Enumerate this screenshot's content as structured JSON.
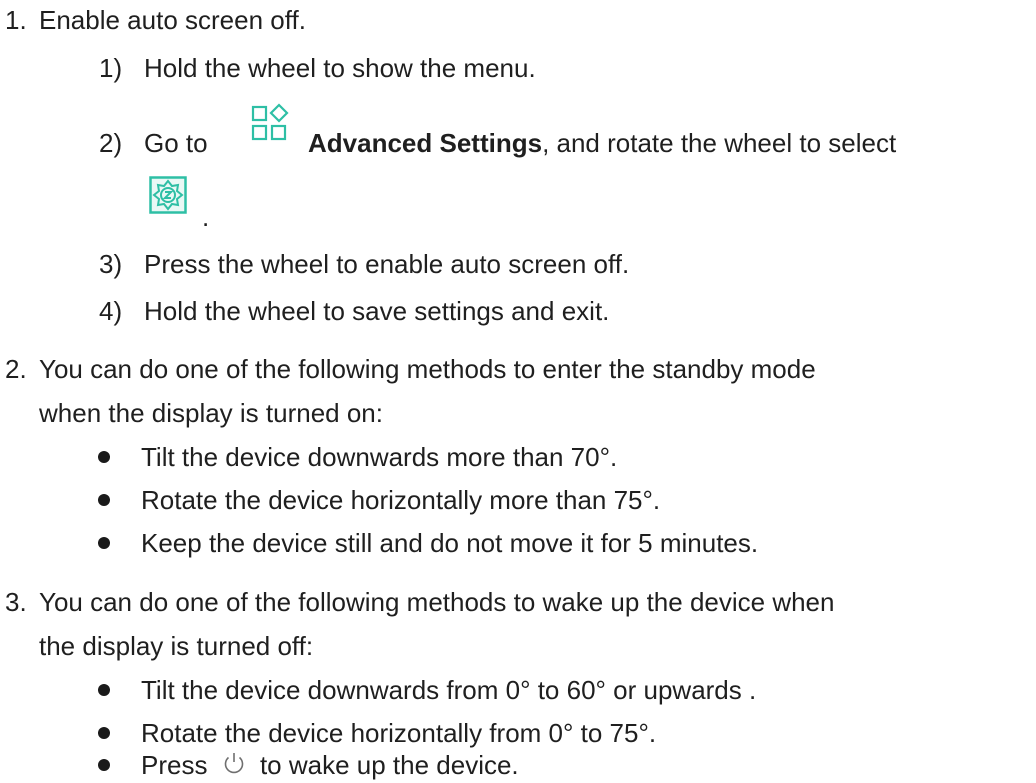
{
  "items": [
    {
      "num": "1.",
      "text": "Enable auto screen off.",
      "steps": [
        {
          "num": "1)",
          "text": "Hold the wheel to show the menu."
        },
        {
          "num": "2)",
          "pre": "Go to",
          "bold": "Advanced Settings",
          "post": ", and rotate the wheel to select",
          "icon": "advanced-settings-icon",
          "icon2": "auto-screen-off-icon",
          "end": "."
        },
        {
          "num": "3)",
          "text": "Press the wheel to enable auto screen off."
        },
        {
          "num": "4)",
          "text": "Hold the wheel to save settings and exit."
        }
      ]
    },
    {
      "num": "2.",
      "text1": "You can do one of the following methods to enter the standby mode",
      "text2": "when the display is turned on:",
      "bullets": [
        "Tilt the device downwards more than 70°.",
        "Rotate the device horizontally more than 75°.",
        "Keep the device still and do not move it for 5 minutes."
      ]
    },
    {
      "num": "3.",
      "text1": "You can do one of the following methods to wake up the device when",
      "text2": "the display is turned off:",
      "bullets": [
        "Tilt the device downwards from 0° to 60° or upwards .",
        "Rotate the device horizontally from 0° to 75°."
      ],
      "last_bullet": {
        "pre": "Press",
        "icon": "power-icon",
        "post": "to wake up the device."
      }
    }
  ],
  "colors": {
    "icon": "#2ebfa5",
    "text": "#1f1f1f"
  }
}
